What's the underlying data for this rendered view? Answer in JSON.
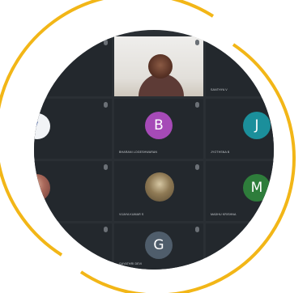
{
  "meeting": {
    "tiles": [
      {
        "id": "t1",
        "name": "",
        "kind": "empty"
      },
      {
        "id": "t2",
        "name": "",
        "kind": "video"
      },
      {
        "id": "t3",
        "name": "SANTHYA V",
        "kind": "empty"
      },
      {
        "id": "t4",
        "name": "",
        "kind": "logo"
      },
      {
        "id": "t5",
        "name": "BHARANI LOGESHWARAN",
        "initial": "B",
        "kind": "avatar",
        "color": "#a64ab7"
      },
      {
        "id": "t6",
        "name": "JYOTHSNA B",
        "initial": "J",
        "kind": "avatar",
        "color": "#1b8f9b"
      },
      {
        "id": "t7",
        "name": "",
        "kind": "photo"
      },
      {
        "id": "t8",
        "name": "VIJAYA KUMAR S",
        "kind": "photo-group"
      },
      {
        "id": "t9",
        "name": "MADHU KRISHNA",
        "initial": "M",
        "kind": "avatar",
        "color": "#2e7d3b"
      },
      {
        "id": "t10",
        "name": "",
        "kind": "empty"
      },
      {
        "id": "t11",
        "name": "GAYATHRI DEVI",
        "initial": "G",
        "kind": "avatar",
        "color": "#4f5d6b"
      },
      {
        "id": "t12",
        "name": "",
        "kind": "empty"
      }
    ]
  },
  "colors": {
    "ring": "#f2b617",
    "lens_bg": "#2a2f34",
    "tile_bg": "#23282d"
  },
  "icons": {
    "ring": "circular-ring-frame",
    "mic": "mic-off-icon"
  }
}
